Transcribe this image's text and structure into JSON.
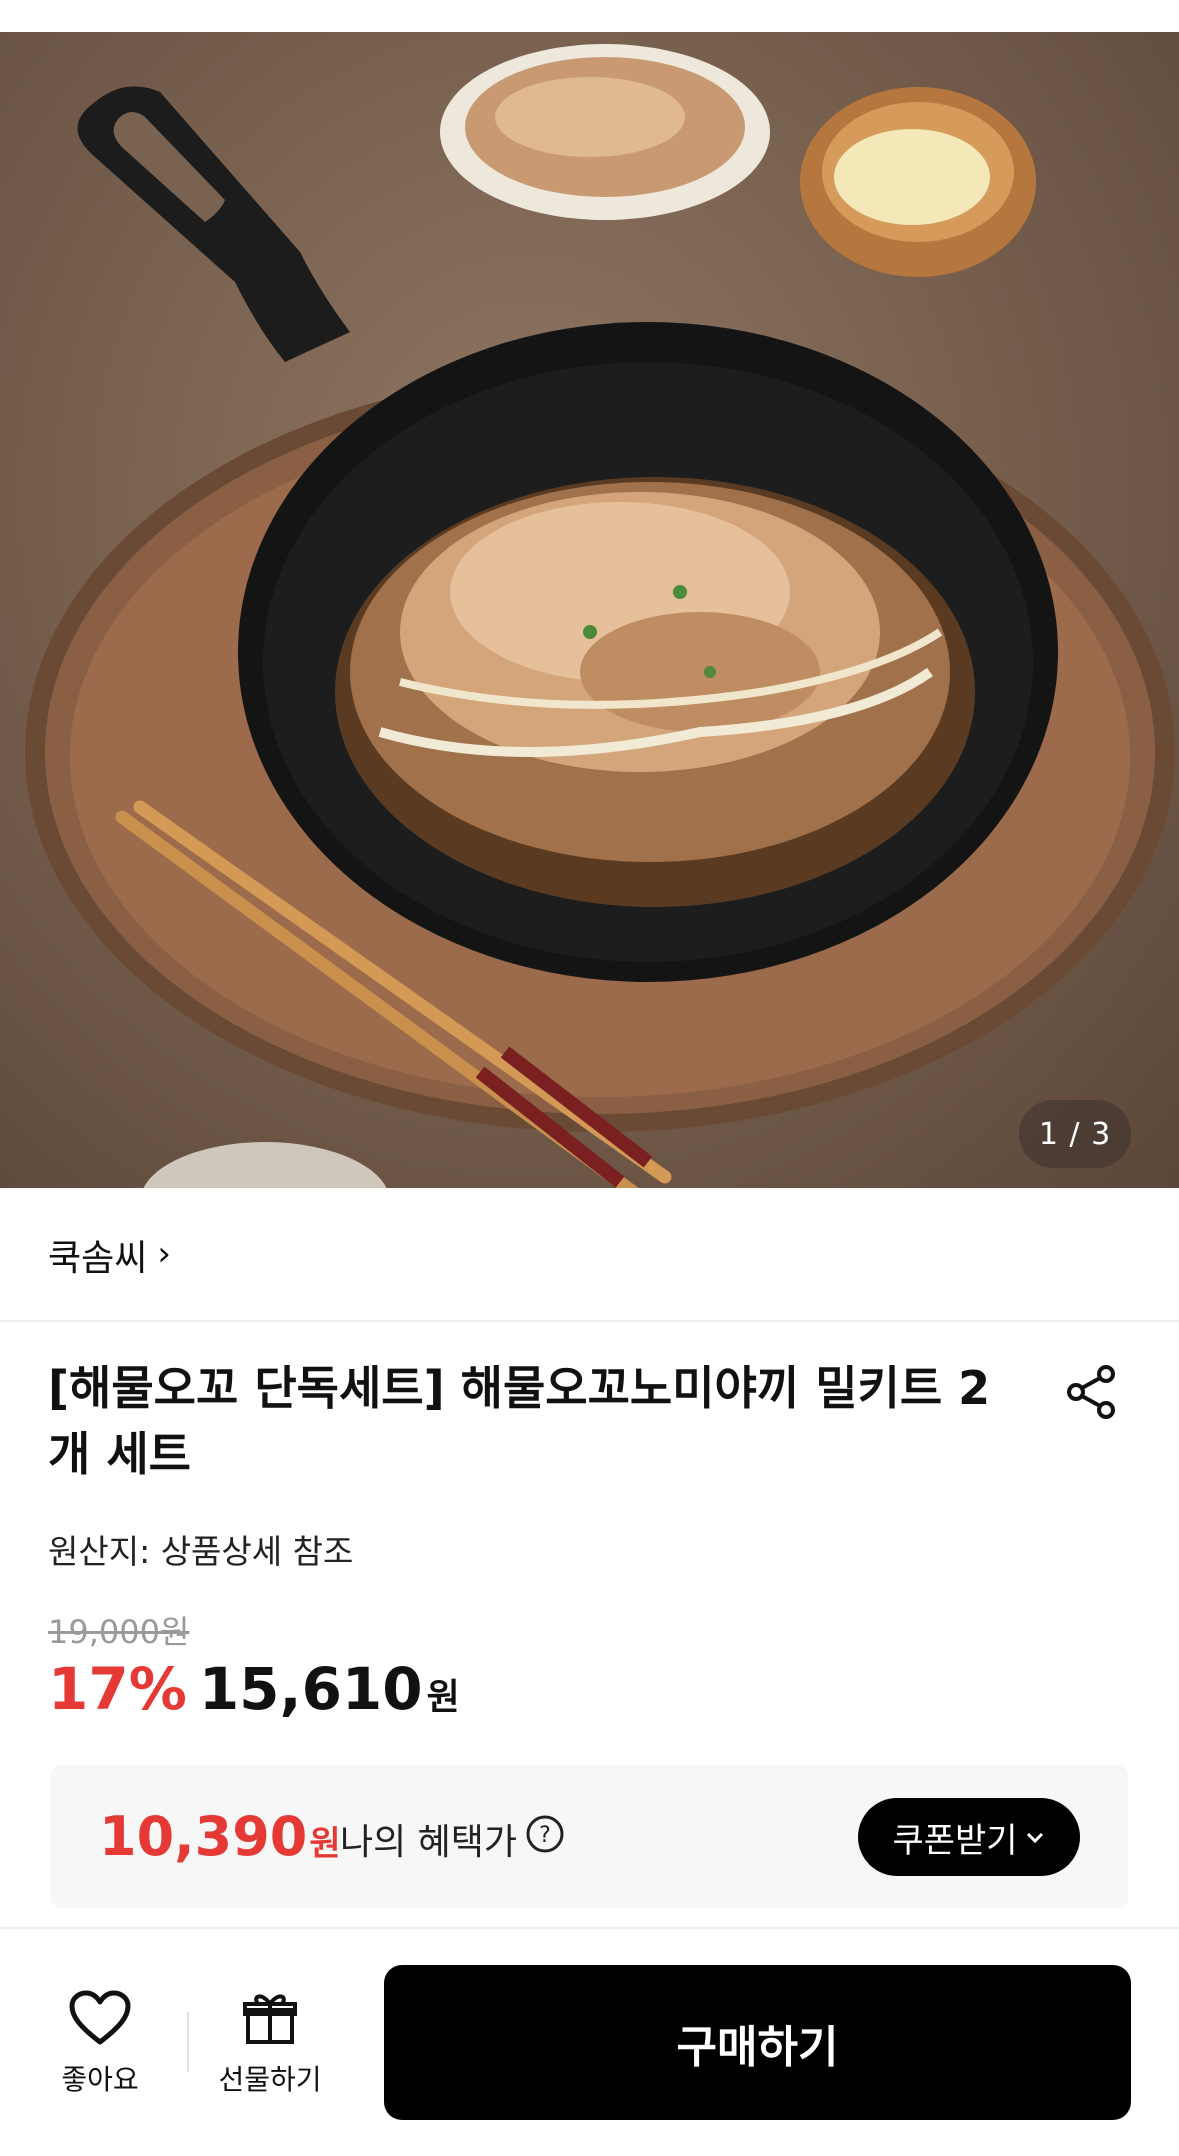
{
  "gallery": {
    "counter": "1 / 3",
    "image_description_icon": "product-photo"
  },
  "shop": {
    "name": "쿡솜씨",
    "chevron": "›"
  },
  "product": {
    "title": "[해물오꼬 단독세트] 해물오꼬노미야끼 밀키트 2개 세트",
    "origin": "원산지: 상품상세 참조",
    "original_price": "19,000원",
    "discount": "17%",
    "price": "15,610",
    "price_unit": "원"
  },
  "benefit": {
    "price": "10,390",
    "price_unit": "원",
    "label": "나의 혜택가",
    "coupon_button": "쿠폰받기"
  },
  "bottom_bar": {
    "like_label": "좋아요",
    "gift_label": "선물하기",
    "buy_label": "구매하기"
  },
  "colors": {
    "accent_red": "#e53935",
    "primary_black": "#000000"
  }
}
